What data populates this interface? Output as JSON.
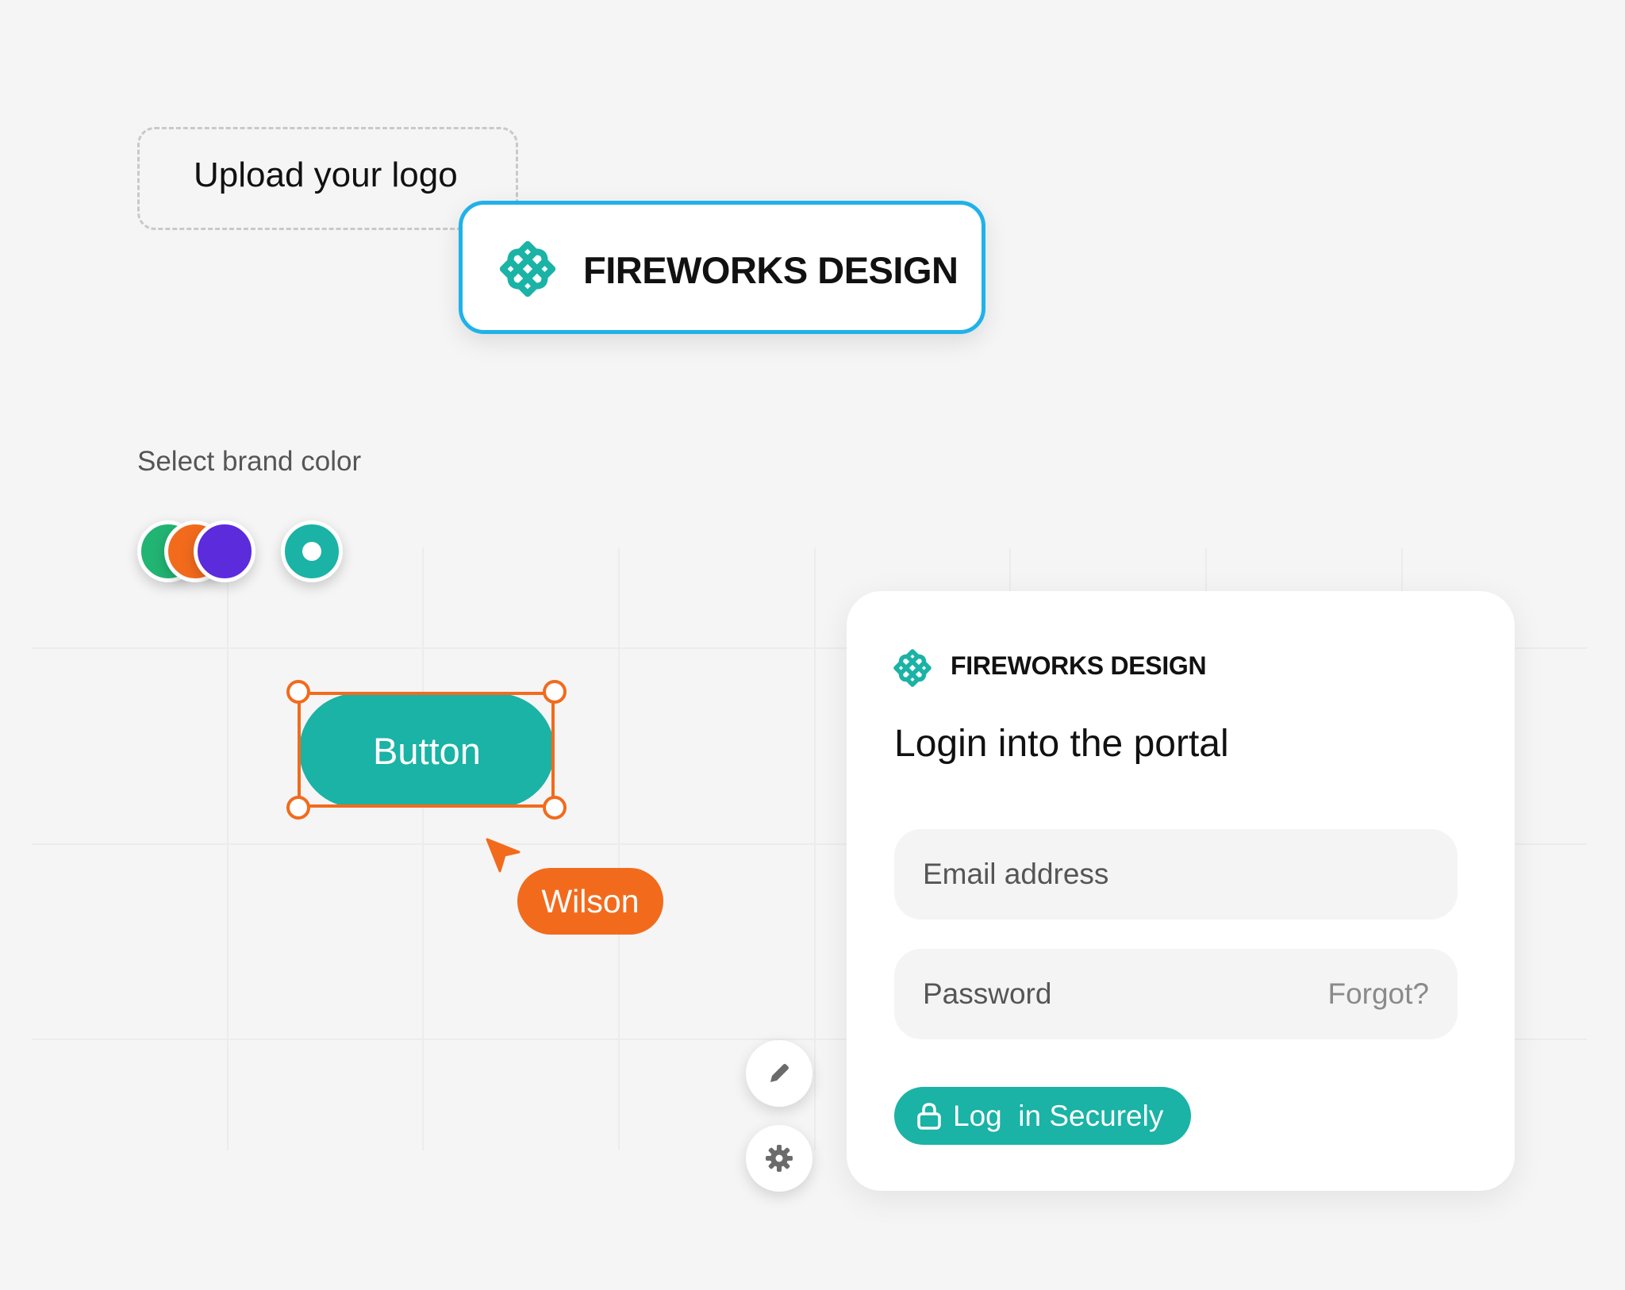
{
  "upload": {
    "label": "Upload your logo"
  },
  "logo_card": {
    "brand_name": "FIREWORKS DESIGN",
    "icon": "brand-flower-icon",
    "border_color": "#1fb2ea"
  },
  "brand_color": {
    "label": "Select brand color",
    "swatches": [
      {
        "name": "green",
        "color": "#22b473"
      },
      {
        "name": "orange",
        "color": "#f26b1d"
      },
      {
        "name": "purple",
        "color": "#5b2bdc"
      },
      {
        "name": "teal",
        "color": "#1ab3a6",
        "selected": true
      }
    ]
  },
  "canvas": {
    "button_label": "Button",
    "collaborator_name": "Wilson",
    "collaborator_color": "#f26b1d",
    "selection_color": "#f26b1d"
  },
  "tools": {
    "edit_icon": "pencil-icon",
    "settings_icon": "gear-icon"
  },
  "login": {
    "brand_name": "FIREWORKS DESIGN",
    "title": "Login into the portal",
    "email_placeholder": "Email address",
    "password_placeholder": "Password",
    "forgot_label": "Forgot?",
    "submit_label": "Log  in Securely",
    "accent_color": "#1ab3a6"
  }
}
